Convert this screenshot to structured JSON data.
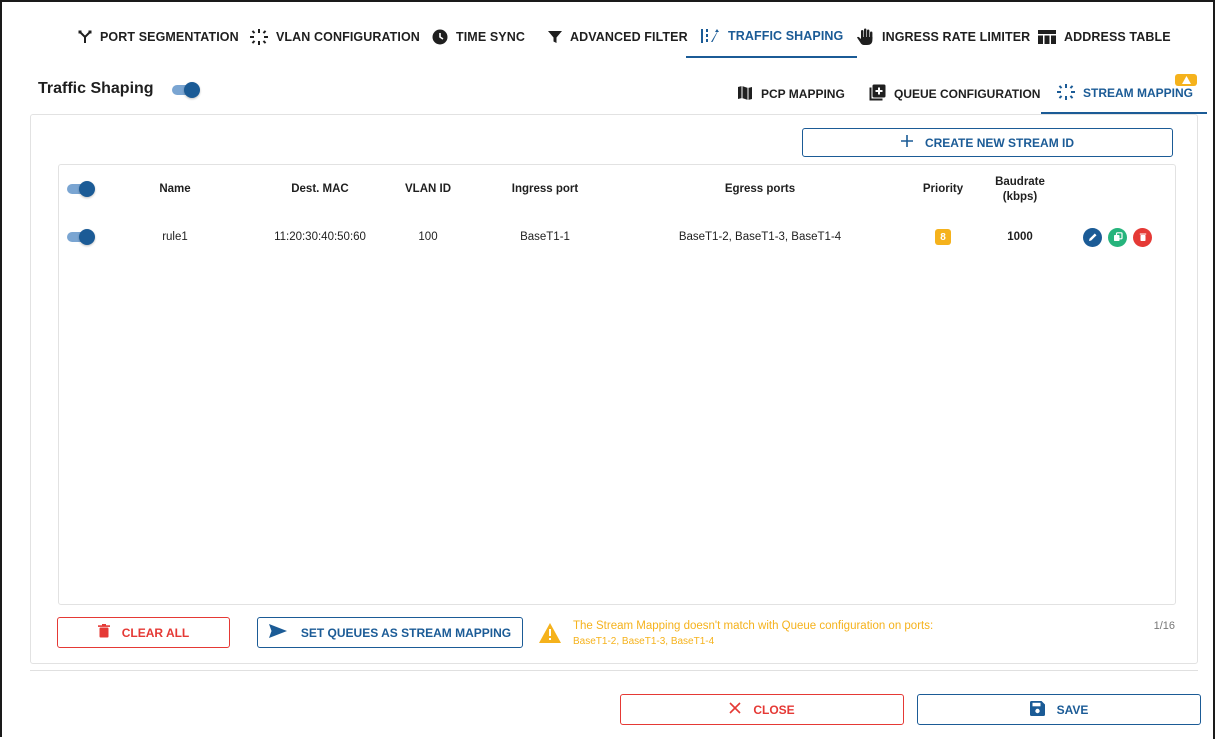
{
  "colors": {
    "primary": "#1b5b96",
    "danger": "#e53935",
    "warning": "#f5b21c"
  },
  "top_tabs": [
    {
      "label": "PORT SEGMENTATION",
      "icon": "port-segmentation-icon"
    },
    {
      "label": "VLAN CONFIGURATION",
      "icon": "vlan-icon"
    },
    {
      "label": "TIME SYNC",
      "icon": "clock-icon"
    },
    {
      "label": "ADVANCED FILTER",
      "icon": "filter-icon"
    },
    {
      "label": "TRAFFIC SHAPING",
      "icon": "traffic-shaping-icon",
      "active": true
    },
    {
      "label": "INGRESS RATE LIMITER",
      "icon": "hand-icon"
    },
    {
      "label": "ADDRESS TABLE",
      "icon": "table-icon"
    }
  ],
  "section": {
    "title": "Traffic Shaping",
    "enabled": true
  },
  "sub_tabs": [
    {
      "label": "PCP MAPPING",
      "icon": "map-icon"
    },
    {
      "label": "QUEUE CONFIGURATION",
      "icon": "add-box-icon"
    },
    {
      "label": "STREAM MAPPING",
      "icon": "stream-icon",
      "active": true,
      "warning": true
    }
  ],
  "toolbar": {
    "create_label": "CREATE NEW STREAM ID"
  },
  "table": {
    "headers": {
      "name": "Name",
      "dest_mac": "Dest. MAC",
      "vlan_id": "VLAN ID",
      "ingress_port": "Ingress port",
      "egress_ports": "Egress ports",
      "priority": "Priority",
      "baudrate_line1": "Baudrate",
      "baudrate_line2": "(kbps)"
    },
    "rows": [
      {
        "enabled": true,
        "name": "rule1",
        "dest_mac": "11:20:30:40:50:60",
        "vlan_id": "100",
        "ingress_port": "BaseT1-1",
        "egress_ports": "BaseT1-2, BaseT1-3, BaseT1-4",
        "priority": "8",
        "baudrate": "1000"
      }
    ]
  },
  "footer": {
    "clear_label": "CLEAR ALL",
    "set_queues_label": "SET QUEUES AS STREAM MAPPING",
    "warning_message": "The Stream Mapping doesn't match with Queue configuration on ports:",
    "warning_ports": "BaseT1-2, BaseT1-3, BaseT1-4",
    "pager": "1/16"
  },
  "dialog": {
    "close_label": "CLOSE",
    "save_label": "SAVE"
  }
}
